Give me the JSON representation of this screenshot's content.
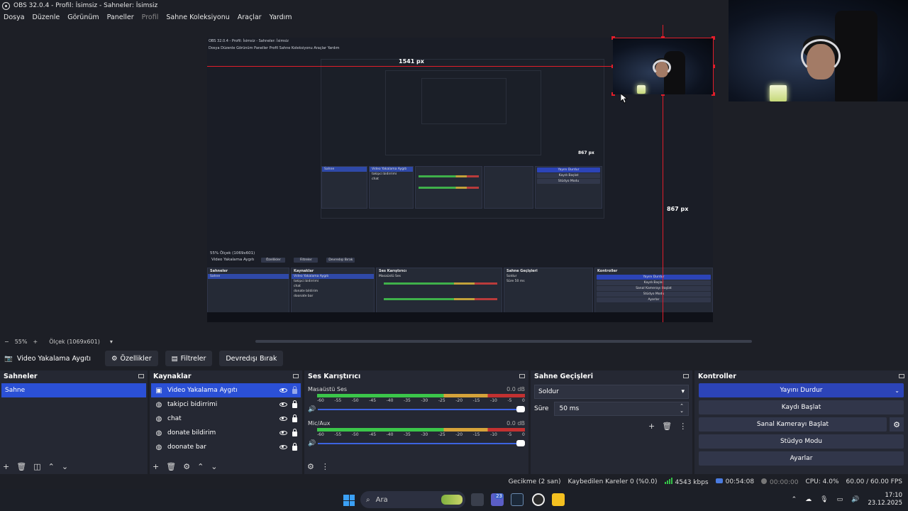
{
  "window": {
    "title": "OBS 32.0.4 - Profil: İsimsiz - Sahneler: İsimsiz"
  },
  "menu": [
    "Dosya",
    "Düzenle",
    "Görünüm",
    "Paneller",
    "Profil",
    "Sahne Koleksiyonu",
    "Araçlar",
    "Yardım"
  ],
  "preview": {
    "px_label_width": "1541 px",
    "px_label_height": "867 px",
    "px_label_small": "867 px",
    "nested_title": "OBS 32.0.4 - Profil: İsimsiz - Sahneler: İsimsiz",
    "nested_menu": "Dosya   Düzenle   Görünüm   Paneller   Profil   Sahne Koleksiyonu   Araçlar   Yardım",
    "nested_zoom": "55%   Ölçek (1069x601)",
    "nested_source": "Video Yakalama Aygıtı",
    "nested_btns": [
      "Özellikler",
      "Filtreler",
      "Devredışı Bırak"
    ]
  },
  "zoom": {
    "minus": "−",
    "value": "55%",
    "plus": "+",
    "scale": "Ölçek (1069x601)"
  },
  "source_toolbar": {
    "current": "Video Yakalama Aygıtı",
    "properties": "Özellikler",
    "filters": "Filtreler",
    "disable": "Devredışı Bırak"
  },
  "scenes": {
    "title": "Sahneler",
    "items": [
      "Sahne"
    ]
  },
  "sources": {
    "title": "Kaynaklar",
    "items": [
      "Video Yakalama Aygıtı",
      "takipci bidirrimi",
      "chat",
      "donate bildirim",
      "doonate bar"
    ]
  },
  "mixer": {
    "title": "Ses Karıştırıcı",
    "channels": [
      {
        "name": "Masaüstü Ses",
        "db": "0.0 dB"
      },
      {
        "name": "Mic/Aux",
        "db": "0.0 dB"
      }
    ],
    "scale": [
      "-60",
      "-55",
      "-50",
      "-45",
      "-40",
      "-35",
      "-30",
      "-25",
      "-20",
      "-15",
      "-10",
      "-5",
      "0"
    ]
  },
  "transitions": {
    "title": "Sahne Geçişleri",
    "selected": "Soldur",
    "duration_label": "Süre",
    "duration": "50 ms"
  },
  "controls": {
    "title": "Kontroller",
    "stop_stream": "Yayını Durdur",
    "start_record": "Kaydı Başlat",
    "virtual_cam": "Sanal Kamerayı Başlat",
    "studio": "Stüdyo Modu",
    "settings": "Ayarlar"
  },
  "status": {
    "delay": "Gecikme (2 san)",
    "dropped": "Kaybedilen Kareler 0 (%0.0)",
    "bitrate": "4543 kbps",
    "stream_time": "00:54:08",
    "rec_time": "00:00:00",
    "cpu": "CPU: 4.0%",
    "fps": "60.00 / 60.00 FPS"
  },
  "taskbar": {
    "search": "Ara",
    "badge": "23",
    "time": "17:10",
    "date": "23.12.2025"
  },
  "colors": {
    "accent": "#2b50d6",
    "stream_btn": "#2c44b8",
    "guide": "#e11d2a",
    "bg": "#1d1f26"
  }
}
